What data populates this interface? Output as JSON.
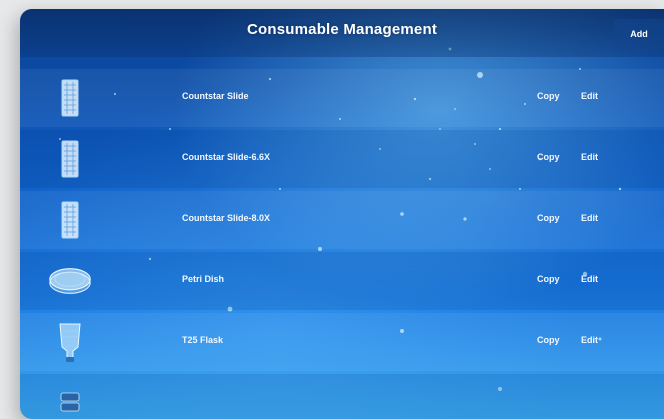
{
  "header": {
    "title": "Consumable Management",
    "add_label": "Add"
  },
  "rows": [
    {
      "name": "Countstar Slide",
      "copy_label": "Copy",
      "edit_label": "Edit",
      "icon": "slide-icon"
    },
    {
      "name": "Countstar Slide-6.6X",
      "copy_label": "Copy",
      "edit_label": "Edit",
      "icon": "slide-icon"
    },
    {
      "name": "Countstar Slide-8.0X",
      "copy_label": "Copy",
      "edit_label": "Edit",
      "icon": "slide-icon"
    },
    {
      "name": "Petri Dish",
      "copy_label": "Copy",
      "edit_label": "Edit",
      "icon": "petri-dish-icon"
    },
    {
      "name": "T25 Flask",
      "copy_label": "Copy",
      "edit_label": "Edit",
      "icon": "flask-icon"
    },
    {
      "name": "",
      "copy_label": "",
      "edit_label": "",
      "icon": "plate-icon"
    }
  ],
  "colors": {
    "accent": "#0e5bc1",
    "text": "#f2f8ff"
  }
}
